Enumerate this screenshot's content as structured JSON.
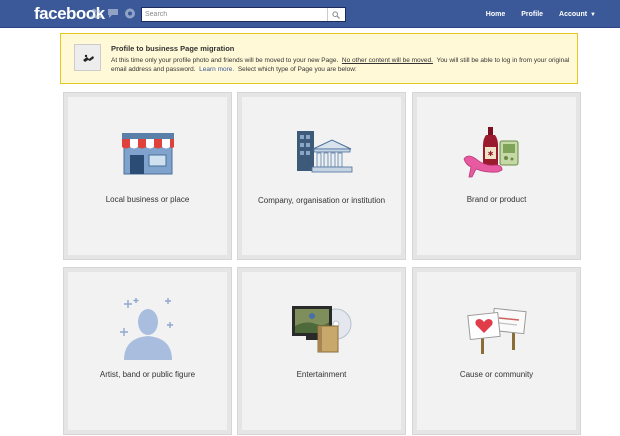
{
  "header": {
    "logo": "facebook",
    "search_placeholder": "Search",
    "nav": {
      "home": "Home",
      "profile": "Profile",
      "account": "Account"
    }
  },
  "notice": {
    "title": "Profile to business Page migration",
    "body_1": "At this time only your profile photo and friends will be moved to your new Page.",
    "body_underlined": "No other content will be moved.",
    "body_2": "You will still be able to log in from your original email address and password.",
    "learn_more": "Learn more.",
    "body_3": "Select which type of Page you are below:"
  },
  "categories": [
    {
      "label": "Local business or place",
      "icon": "storefront-icon"
    },
    {
      "label": "Company, organisation or institution",
      "icon": "company-buildings-icon"
    },
    {
      "label": "Brand or product",
      "icon": "brand-product-icon"
    },
    {
      "label": "Artist, band or public figure",
      "icon": "artist-silhouette-icon"
    },
    {
      "label": "Entertainment",
      "icon": "entertainment-icon"
    },
    {
      "label": "Cause or community",
      "icon": "cause-signs-icon"
    }
  ],
  "colors": {
    "brand_blue": "#3b5998",
    "notice_bg": "#fff9d7",
    "notice_border": "#e2c822",
    "tile_bg": "#f2f2f2"
  }
}
